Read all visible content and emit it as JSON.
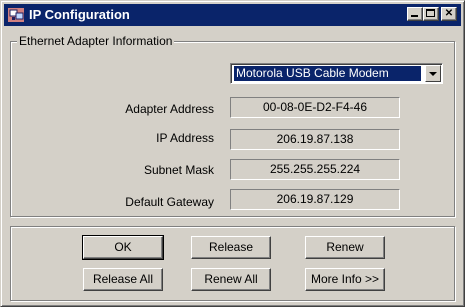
{
  "window": {
    "title": "IP Configuration",
    "icon": "network-computer-icon",
    "controls": {
      "minimize": "minimize-icon",
      "maximize": "maximize-icon",
      "close": "close-icon"
    }
  },
  "adapter_group": {
    "label": "Ethernet  Adapter Information",
    "selected_adapter": "Motorola USB Cable Modem",
    "rows": [
      {
        "label": "Adapter Address",
        "value": "00-08-0E-D2-F4-46"
      },
      {
        "label": "IP Address",
        "value": "206.19.87.138"
      },
      {
        "label": "Subnet Mask",
        "value": "255.255.255.224"
      },
      {
        "label": "Default Gateway",
        "value": "206.19.87.129"
      }
    ]
  },
  "buttons": {
    "ok": "OK",
    "release": "Release",
    "renew": "Renew",
    "release_all": "Release All",
    "renew_all": "Renew All",
    "more_info": "More Info >>"
  },
  "colors": {
    "title_bar": "#0a246a",
    "face": "#d4d0c8",
    "selection": "#0a246a"
  }
}
